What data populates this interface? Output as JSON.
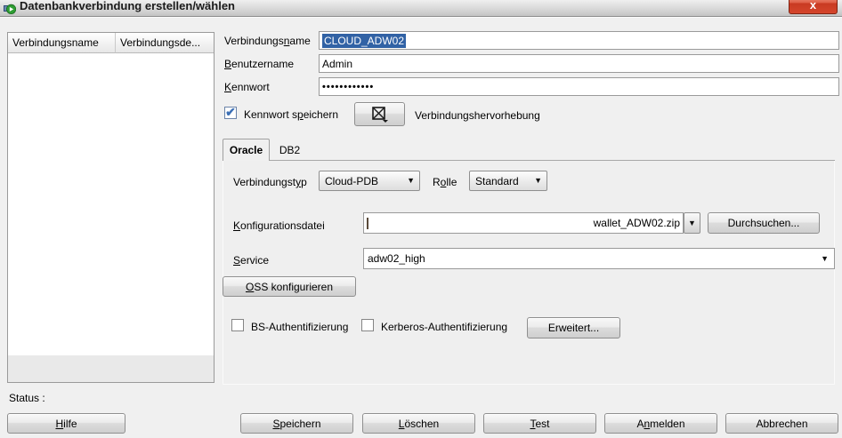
{
  "titlebar": {
    "title": "Datenbankverbindung erstellen/wählen",
    "close": "x"
  },
  "list": {
    "columns": {
      "0": "Verbindungsname",
      "1": "Verbindungsde..."
    }
  },
  "fields": {
    "name": {
      "pre": "Verbindungs",
      "mn": "n",
      "post": "ame",
      "value": "CLOUD_ADW02"
    },
    "user": {
      "pre": "",
      "mn": "B",
      "post": "enutzername",
      "value": "Admin"
    },
    "password": {
      "pre": "",
      "mn": "K",
      "post": "ennwort",
      "value": "••••••••••••"
    },
    "save_password": {
      "pre": "Kennwort s",
      "mn": "p",
      "post": "eichern",
      "checked": true
    },
    "color_label": "Verbindungshervorhebung"
  },
  "tabs": {
    "oracle": "Oracle",
    "db2": "DB2"
  },
  "oracle_tab": {
    "conn_type": {
      "pre": "Verbindungst",
      "mn": "y",
      "post": "p",
      "value": "Cloud-PDB"
    },
    "role": {
      "pre": "R",
      "mn": "o",
      "post": "lle",
      "value": "Standard"
    },
    "config_file": {
      "pre": "",
      "mn": "K",
      "post": "onfigurationsdatei",
      "value": "wallet_ADW02.zip"
    },
    "browse": "Durchsuchen...",
    "service": {
      "pre": "",
      "mn": "S",
      "post": "ervice",
      "value": "adw02_high"
    },
    "oss": {
      "pre": "",
      "mn": "O",
      "post": "SS konfigurieren"
    },
    "os_auth": "BS-Authentifizierung",
    "kerberos_auth": "Kerberos-Authentifizierung",
    "advanced": "Erweitert..."
  },
  "status": {
    "label": "Status :"
  },
  "buttons": {
    "help": {
      "pre": "",
      "mn": "H",
      "post": "ilfe"
    },
    "save": {
      "pre": "",
      "mn": "S",
      "post": "peichern"
    },
    "delete": {
      "pre": "",
      "mn": "L",
      "post": "öschen"
    },
    "test": {
      "pre": "",
      "mn": "T",
      "post": "est"
    },
    "connect": {
      "pre": "A",
      "mn": "n",
      "post": "melden"
    },
    "cancel": {
      "label": "Abbrechen"
    }
  },
  "colors": {
    "selection_blue": "#3162a5",
    "check_blue": "#3b6fb5",
    "close_red": "#d5452c"
  }
}
